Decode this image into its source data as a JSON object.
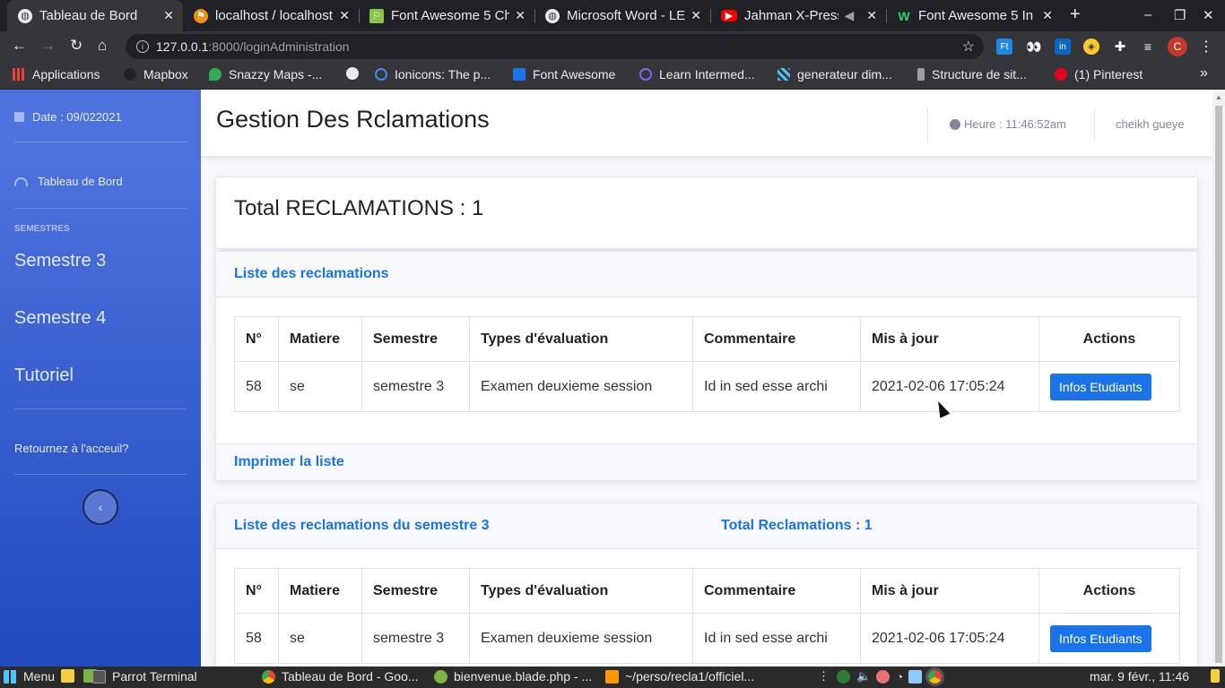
{
  "browser": {
    "tabs": [
      {
        "title": "Tableau de Bord",
        "icon": "globe-icon",
        "color": "#5f6368"
      },
      {
        "title": "localhost / localhost",
        "icon": "phpmyadmin-icon",
        "color": "#f29111"
      },
      {
        "title": "Font Awesome 5 Ch",
        "icon": "fontawesome-icon",
        "color": "#8bc34a"
      },
      {
        "title": "Microsoft Word - LE",
        "icon": "globe-icon",
        "color": "#5f6368"
      },
      {
        "title": "Jahman X-Press",
        "icon": "youtube-icon",
        "color": "#ff0000"
      },
      {
        "title": "Font Awesome 5 In",
        "icon": "w-icon",
        "color": "#2e7d32"
      }
    ],
    "new_tab": "+",
    "url_host": "127.0.0.1",
    "url_path": ":8000/loginAdministration",
    "profile_initial": "C",
    "bookmarks": [
      {
        "label": "Applications",
        "icon": "apps-grid-icon",
        "color": "#ea4335"
      },
      {
        "label": "Mapbox",
        "icon": "mapbox-icon",
        "color": "#222"
      },
      {
        "label": "Snazzy Maps -...",
        "icon": "map-pin-icon",
        "color": "#34a853"
      },
      {
        "label": "",
        "icon": "globe-icon",
        "color": "#e8eaed"
      },
      {
        "label": "Ionicons: The p...",
        "icon": "ionicons-icon",
        "color": "#4285f4"
      },
      {
        "label": "Font Awesome",
        "icon": "flag-icon",
        "color": "#1a73e8"
      },
      {
        "label": "Learn Intermed...",
        "icon": "vue-icon",
        "color": "#7b68ee"
      },
      {
        "label": "generateur dim...",
        "icon": "grid-icon",
        "color": "#4fc3f7"
      },
      {
        "label": "Structure de sit...",
        "icon": "pen-icon",
        "color": "#9e9e9e"
      },
      {
        "label": "(1) Pinterest",
        "icon": "pinterest-icon",
        "color": "#e60023"
      }
    ],
    "bookmarks_overflow": "»"
  },
  "sidebar": {
    "date": "Date : 09/022021",
    "dashboard": "Tableau de Bord",
    "section_heading": "SEMESTRES",
    "items": [
      "Semestre 3",
      "Semestre 4",
      "Tutoriel"
    ],
    "back_link": "Retournez à l'acceuil?",
    "toggle_icon": "‹"
  },
  "topbar": {
    "title": "Gestion Des Rclamations",
    "clock": "Heure : 11:46:52am",
    "user": "cheikh gueye"
  },
  "summary": {
    "total": "Total RECLAMATIONS : 1"
  },
  "list_card": {
    "header": "Liste des reclamations",
    "columns": [
      "N°",
      "Matiere",
      "Semestre",
      "Types d'évaluation",
      "Commentaire",
      "Mis à jour",
      "Actions"
    ],
    "rows": [
      {
        "num": "58",
        "matiere": "se",
        "semestre": "semestre 3",
        "type": "Examen deuxieme session",
        "commentaire": "Id in sed esse archi",
        "date": "2021-02-06 17:05:24",
        "action": "Infos Etudiants"
      }
    ],
    "print_link": "Imprimer la liste"
  },
  "semester_card": {
    "header": "Liste des reclamations du semestre 3",
    "total": "Total Reclamations : 1",
    "columns": [
      "N°",
      "Matiere",
      "Semestre",
      "Types d'évaluation",
      "Commentaire",
      "Mis à jour",
      "Actions"
    ],
    "rows": [
      {
        "num": "58",
        "matiere": "se",
        "semestre": "semestre 3",
        "type": "Examen deuxieme session",
        "commentaire": "Id in sed esse archi",
        "date": "2021-02-06 17:05:24",
        "action": "Infos Etudiants"
      }
    ]
  },
  "taskbar": {
    "menu": "Menu",
    "items": [
      {
        "label": "Parrot Terminal",
        "icon": "terminal-icon",
        "color": "#555"
      },
      {
        "label": "Tableau de Bord - Goo...",
        "icon": "chrome-icon",
        "color": "#4285f4"
      },
      {
        "label": "bienvenue.blade.php - ...",
        "icon": "editor-icon",
        "color": "#7cb342"
      },
      {
        "label": "~/perso/recla1/officiel...",
        "icon": "sublime-icon",
        "color": "#ff9800"
      }
    ],
    "clock": "mar.  9 févr., 11:46"
  }
}
